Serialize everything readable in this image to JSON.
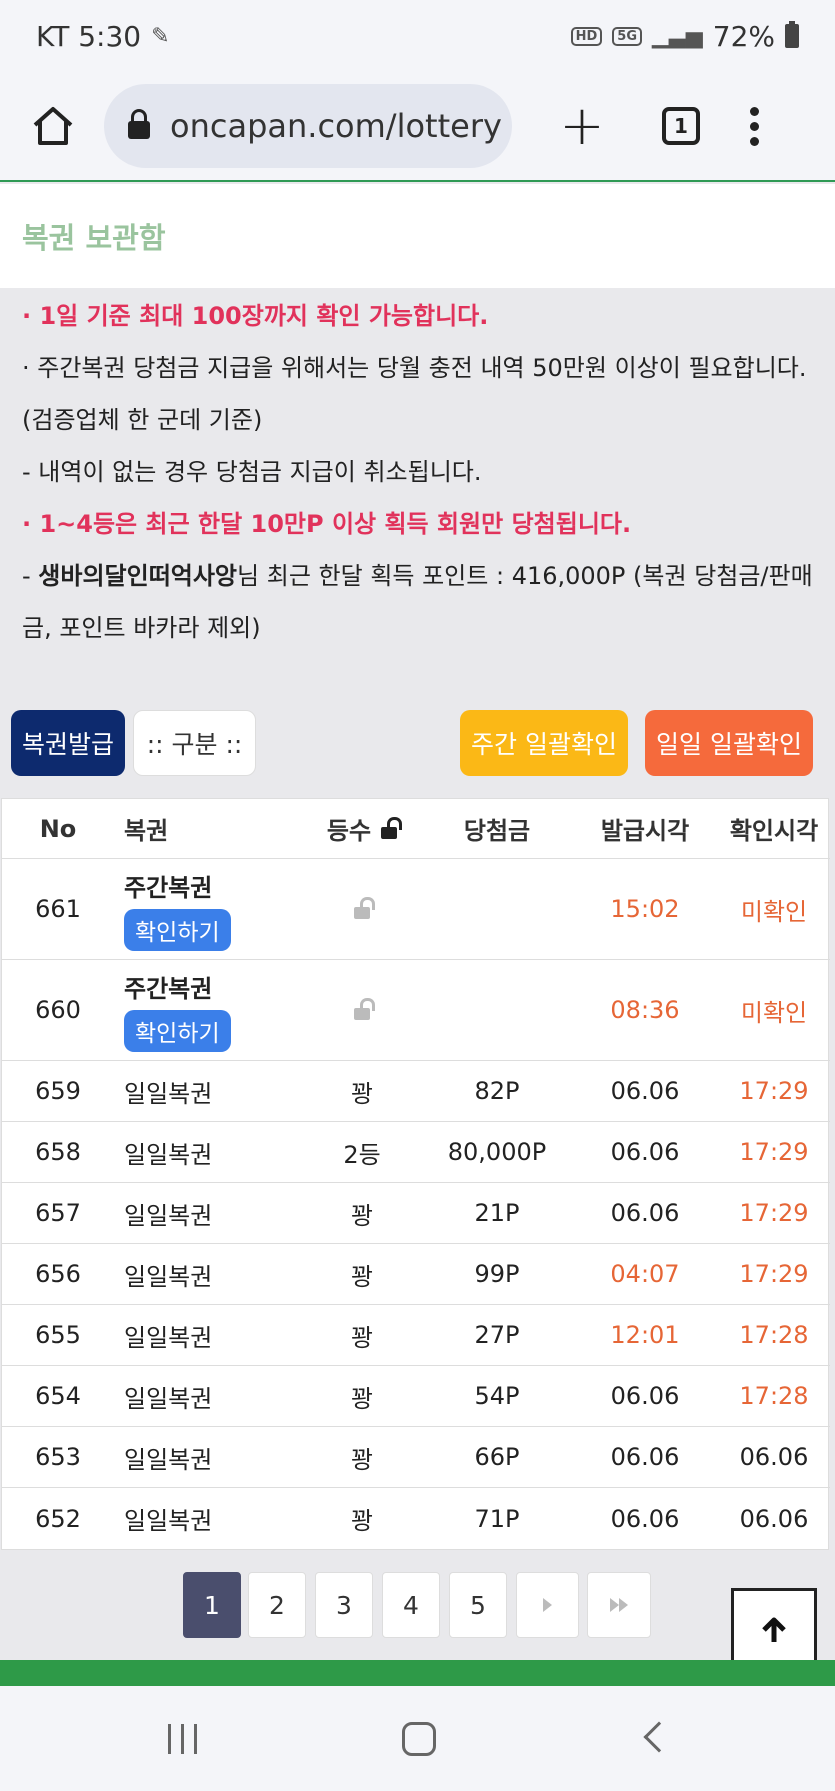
{
  "status_bar": {
    "carrier_time": "KT 5:30",
    "hd_badge": "HD",
    "network": "5G",
    "battery": "72%"
  },
  "browser": {
    "url": "oncapan.com/lottery",
    "tab_count": "1"
  },
  "page_title": "복권 보관함",
  "notices": {
    "line1": "· 1일 기준 최대 100장까지 확인 가능합니다.",
    "line2": "· 주간복권 당첨금 지급을 위해서는 당월 충전 내역 50만원 이상이 필요합니다. (검증업체 한 군데 기준)",
    "line3": "- 내역이 없는 경우 당첨금 지급이 취소됩니다.",
    "line4": "· 1~4등은 최근 한달 10만P 이상 획득 회원만 당첨됩니다.",
    "line5_user": "생바의달인떠억사앙",
    "line5_rest": "님 최근 한달 획득 포인트 : 416,000P (복권 당첨금/판매금, 포인트 바카라 제외)"
  },
  "buttons": {
    "issue": "복권발급",
    "category": ":: 구분 ::",
    "weekly_check": "주간 일괄확인",
    "daily_check": "일일 일괄확인"
  },
  "table": {
    "headers": {
      "no": "No",
      "name": "복권",
      "rank": "등수",
      "prize": "당첨금",
      "issued": "발급시각",
      "checked": "확인시각"
    },
    "check_label": "확인하기",
    "rows": [
      {
        "no": "661",
        "name": "주간복권",
        "rank": "",
        "prize": "",
        "issued": "15:02",
        "checked": "미확인"
      },
      {
        "no": "660",
        "name": "주간복권",
        "rank": "",
        "prize": "",
        "issued": "08:36",
        "checked": "미확인"
      },
      {
        "no": "659",
        "name": "일일복권",
        "rank": "꽝",
        "prize": "82P",
        "issued": "06.06",
        "checked": "17:29"
      },
      {
        "no": "658",
        "name": "일일복권",
        "rank": "2등",
        "prize": "80,000P",
        "issued": "06.06",
        "checked": "17:29"
      },
      {
        "no": "657",
        "name": "일일복권",
        "rank": "꽝",
        "prize": "21P",
        "issued": "06.06",
        "checked": "17:29"
      },
      {
        "no": "656",
        "name": "일일복권",
        "rank": "꽝",
        "prize": "99P",
        "issued": "04:07",
        "checked": "17:29"
      },
      {
        "no": "655",
        "name": "일일복권",
        "rank": "꽝",
        "prize": "27P",
        "issued": "12:01",
        "checked": "17:28"
      },
      {
        "no": "654",
        "name": "일일복권",
        "rank": "꽝",
        "prize": "54P",
        "issued": "06.06",
        "checked": "17:28"
      },
      {
        "no": "653",
        "name": "일일복권",
        "rank": "꽝",
        "prize": "66P",
        "issued": "06.06",
        "checked": "06.06"
      },
      {
        "no": "652",
        "name": "일일복권",
        "rank": "꽝",
        "prize": "71P",
        "issued": "06.06",
        "checked": "06.06"
      }
    ]
  },
  "pagination": {
    "pages": [
      "1",
      "2",
      "3",
      "4",
      "5"
    ],
    "active": "1"
  },
  "colors": {
    "accent_green": "#2e9a48",
    "notice_red": "#e1325b",
    "time_orange": "#e66636",
    "issue_button": "#0d2a6e",
    "weekly_button": "#fbb816",
    "daily_button": "#f56a3c",
    "check_button": "#3b7fe9"
  }
}
